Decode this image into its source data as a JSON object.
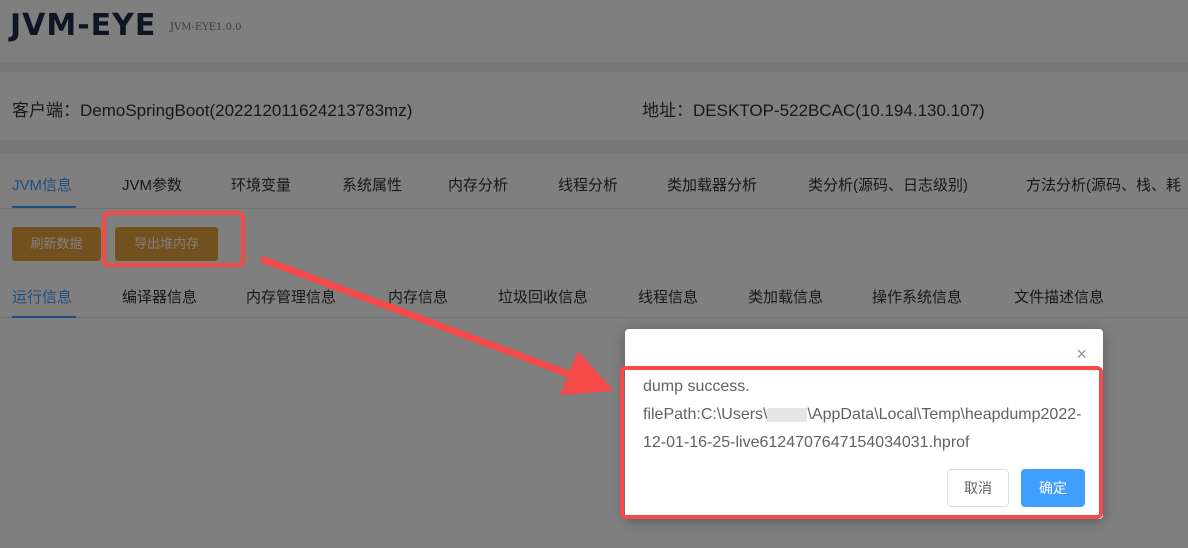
{
  "app": {
    "logo": "JVM-EYE",
    "version": "JVM-EYE1.0.0"
  },
  "info": {
    "client": "客户端：DemoSpringBoot(202212011624213783mz)",
    "address": "地址：DESKTOP-522BCAC(10.194.130.107)"
  },
  "tabs": [
    {
      "label": "JVM信息",
      "active": true
    },
    {
      "label": "JVM参数"
    },
    {
      "label": "环境变量"
    },
    {
      "label": "系统属性"
    },
    {
      "label": "内存分析"
    },
    {
      "label": "线程分析"
    },
    {
      "label": "类加载器分析"
    },
    {
      "label": "类分析(源码、日志级别)"
    },
    {
      "label": "方法分析(源码、栈、耗"
    }
  ],
  "buttons": {
    "refresh": "刷新数据",
    "export_heap": "导出堆内存"
  },
  "subtabs": [
    {
      "label": "运行信息",
      "active": true
    },
    {
      "label": "编译器信息"
    },
    {
      "label": "内存管理信息"
    },
    {
      "label": "内存信息"
    },
    {
      "label": "垃圾回收信息"
    },
    {
      "label": "线程信息"
    },
    {
      "label": "类加载信息"
    },
    {
      "label": "操作系统信息"
    },
    {
      "label": "文件描述信息"
    }
  ],
  "dialog": {
    "message_line1": "dump success.",
    "message_path_prefix": "filePath:C:\\Users\\",
    "message_path_suffix": "\\AppData\\Local\\Temp\\heapdump2022-12-01-16-25-live6124707647154034031.hprof",
    "close_symbol": "×",
    "cancel": "取消",
    "confirm": "确定"
  },
  "colors": {
    "accent": "#409eff",
    "warning": "#e6a23c",
    "annotation_red": "#f44a4a"
  }
}
